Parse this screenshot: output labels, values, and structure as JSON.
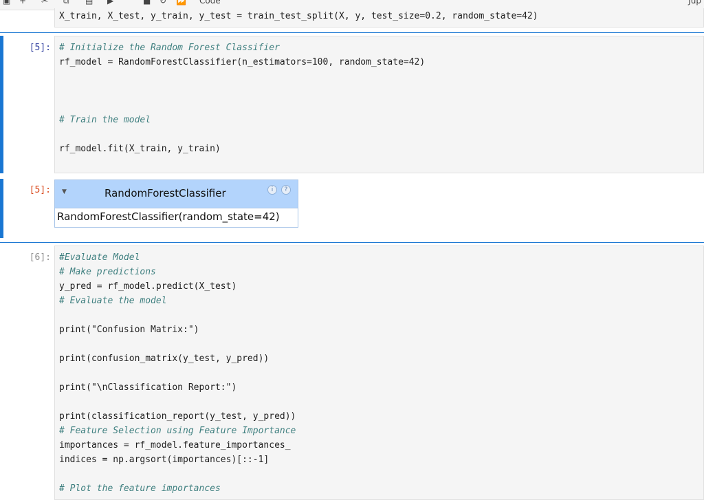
{
  "toolbar": {
    "icons": [
      "save-icon",
      "add-icon",
      "cut-icon",
      "copy-icon",
      "paste-icon",
      "run-icon",
      "stop-icon",
      "restart-icon",
      "run-all-icon"
    ],
    "cell_type": "Code",
    "kernel": "Jup"
  },
  "cells": {
    "split": {
      "line1": "X_train, X_test, y_train, y_test = train_test_split(X, y, test_size=0.2, random_state=42)"
    },
    "cell5": {
      "prompt": "[5]:",
      "comment1": "# Initialize the Random Forest Classifier",
      "line2": "rf_model = RandomForestClassifier(n_estimators=100, random_state=42)",
      "comment2": "# Train the model",
      "line4": "rf_model.fit(X_train, y_train)"
    },
    "output5": {
      "prompt": "[5]:",
      "widget_title": "RandomForestClassifier",
      "widget_body": "RandomForestClassifier(random_state=42)",
      "badge_info": "i",
      "badge_help": "?"
    },
    "cell6": {
      "prompt": "[6]:",
      "lines": [
        "#Evaluate Model",
        "# Make predictions",
        "y_pred = rf_model.predict(X_test)",
        "# Evaluate the model",
        "",
        "print(\"Confusion Matrix:\")",
        "",
        "print(confusion_matrix(y_test, y_pred))",
        "",
        "print(\"\\nClassification Report:\")",
        "",
        "print(classification_report(y_test, y_pred))",
        "# Feature Selection using Feature Importance",
        "importances = rf_model.feature_importances_",
        "indices = np.argsort(importances)[::-1]",
        "",
        "# Plot the feature importances"
      ]
    }
  },
  "colors": {
    "selection": "#1976d2",
    "comment": "#408080",
    "builtin": "#008000",
    "string": "#ba2121",
    "widget_header": "#b3d4fc"
  }
}
